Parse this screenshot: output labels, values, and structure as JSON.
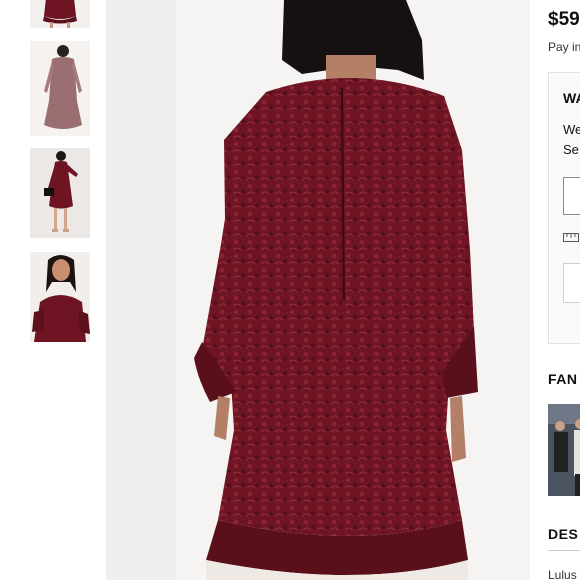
{
  "product": {
    "price": "$59",
    "pay_text": "Pay in"
  },
  "size_card": {
    "title": "WA",
    "line1": "We",
    "line2": "Se"
  },
  "sections": {
    "fan_title": "FAN",
    "description_title": "DES",
    "description_text": "Lulus"
  },
  "colors": {
    "dress": "#6e1422",
    "dress_dark": "#4a0c16",
    "background": "#f6f4f2"
  },
  "thumbnails": [
    {
      "label": "dress-front-crop"
    },
    {
      "label": "dress-back-full"
    },
    {
      "label": "dress-with-clutch"
    },
    {
      "label": "dress-closeup"
    }
  ],
  "icons": {
    "ruler": "ruler-icon"
  }
}
